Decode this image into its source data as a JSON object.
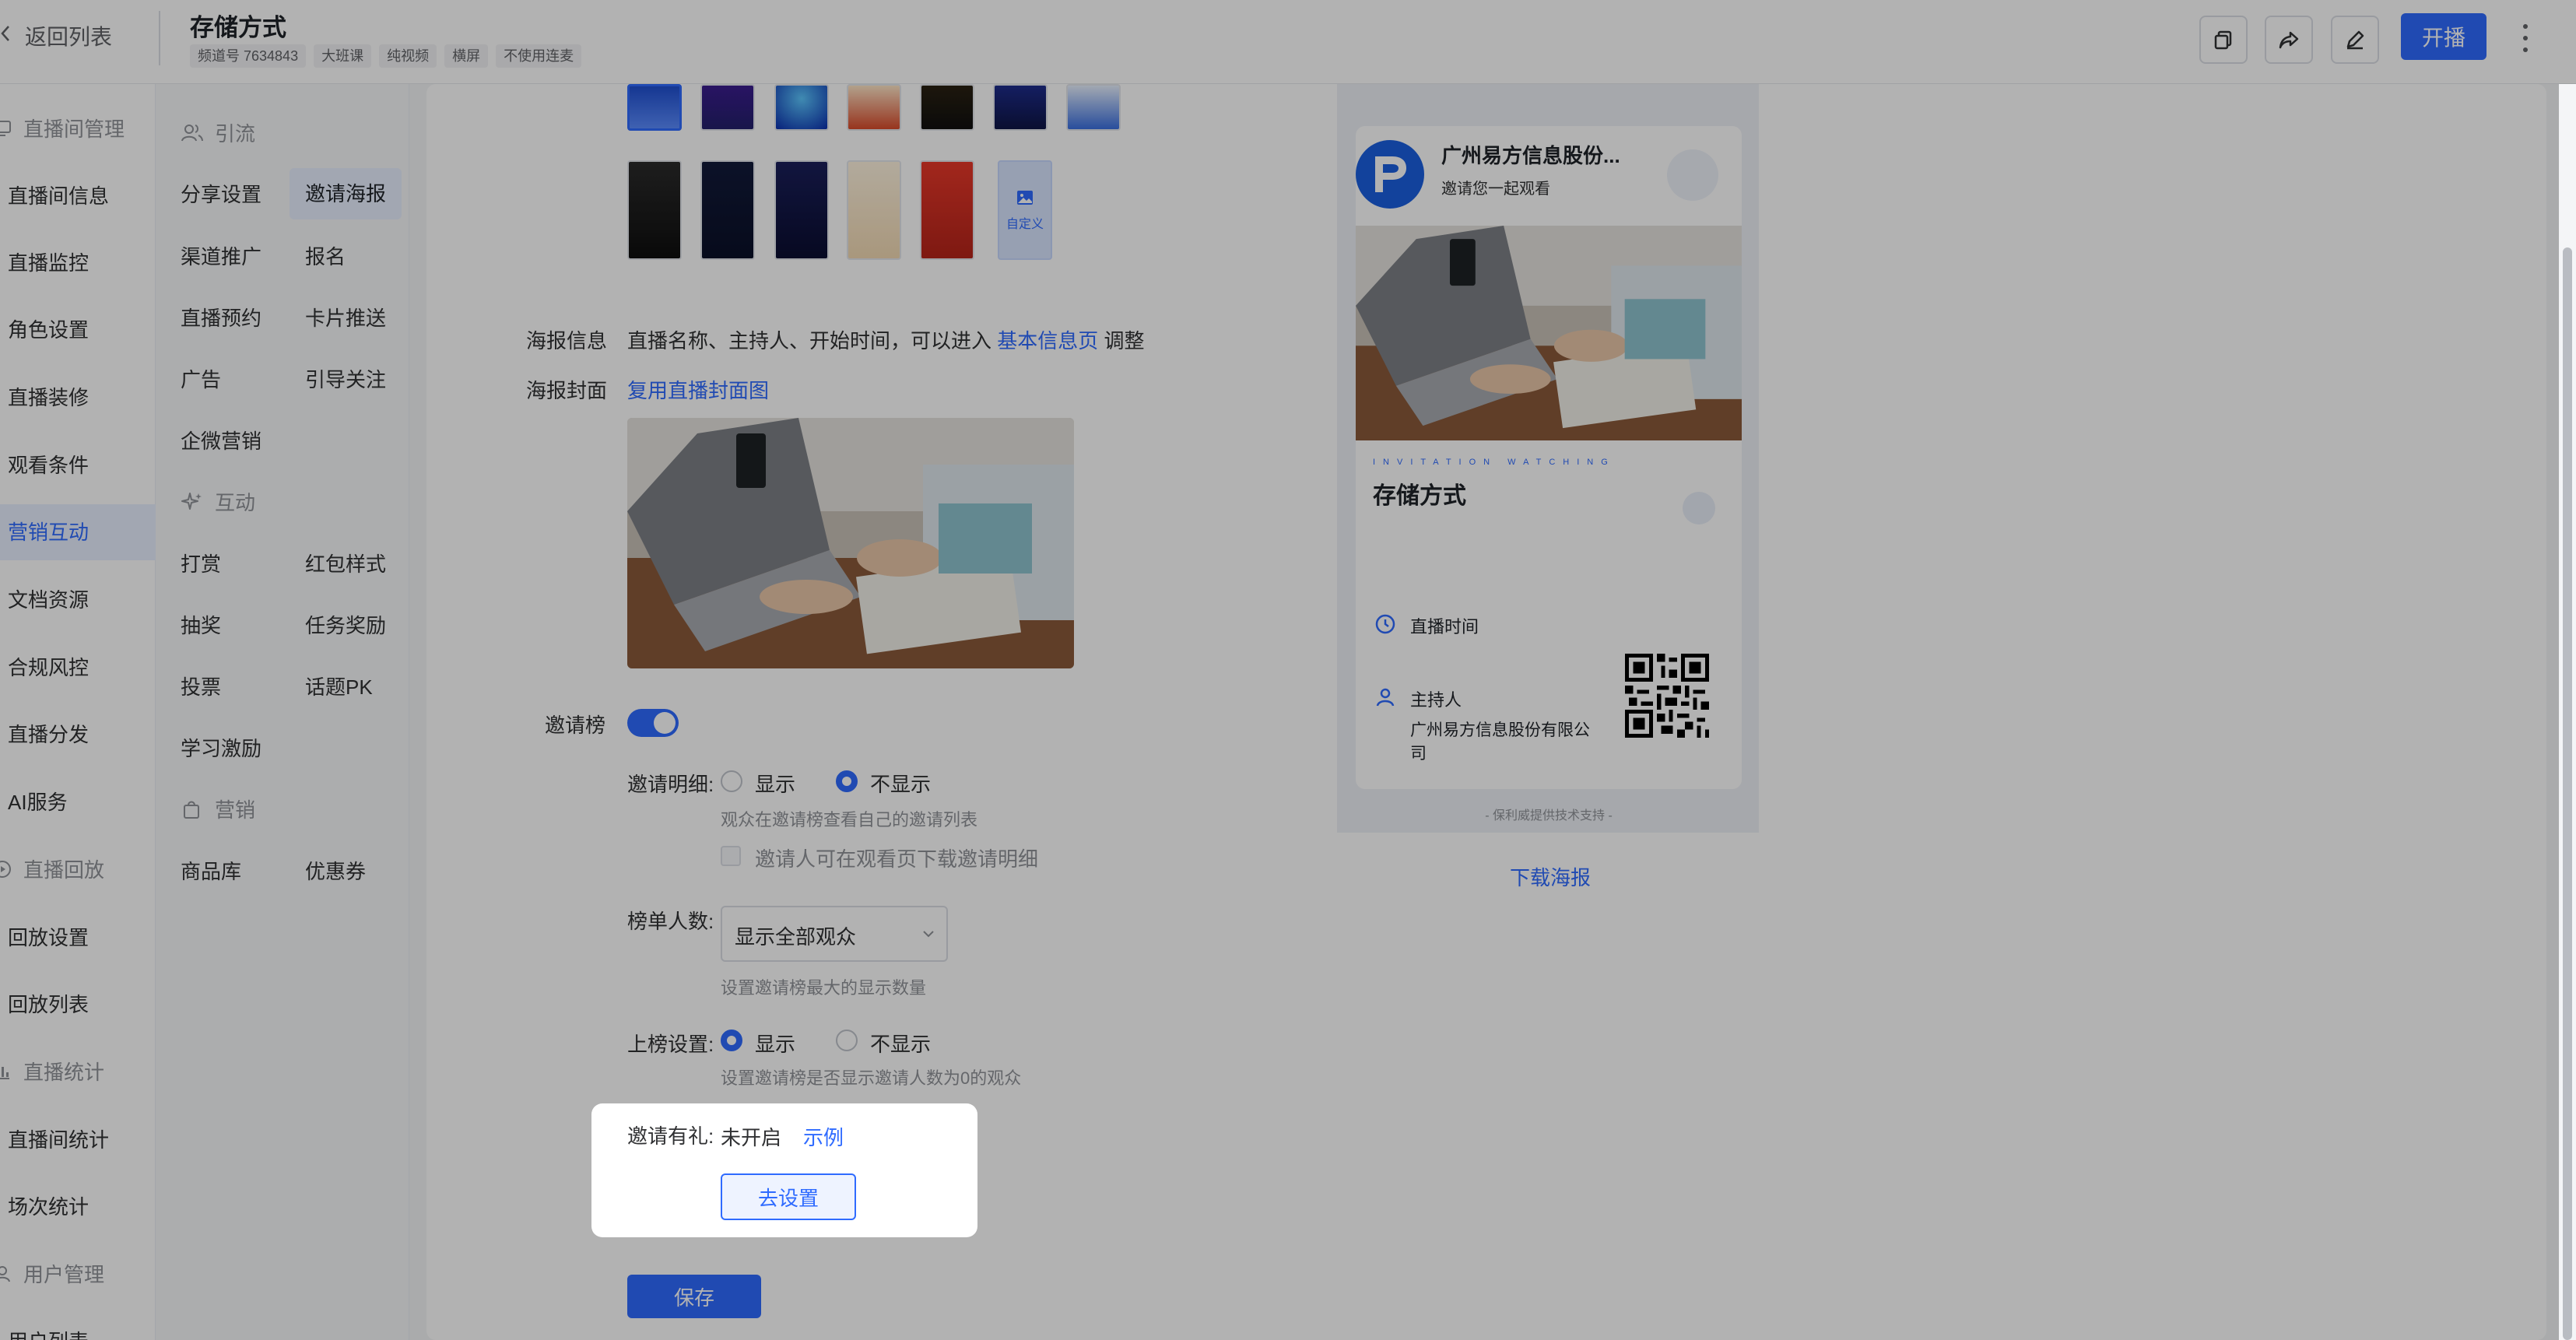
{
  "header": {
    "back_label": "返回列表",
    "title": "存储方式",
    "tags": [
      "频道号 7634843",
      "大班课",
      "纯视频",
      "横屏",
      "不使用连麦"
    ],
    "start_live_label": "开播"
  },
  "sidebar": {
    "items": [
      {
        "label": "直播间管理",
        "group": true
      },
      {
        "label": "直播间信息"
      },
      {
        "label": "直播监控"
      },
      {
        "label": "角色设置"
      },
      {
        "label": "直播装修"
      },
      {
        "label": "观看条件"
      },
      {
        "label": "营销互动",
        "active": true
      },
      {
        "label": "文档资源"
      },
      {
        "label": "合规风控"
      },
      {
        "label": "直播分发"
      },
      {
        "label": "AI服务"
      },
      {
        "label": "直播回放",
        "group": true
      },
      {
        "label": "回放设置"
      },
      {
        "label": "回放列表"
      },
      {
        "label": "直播统计",
        "group": true
      },
      {
        "label": "直播间统计"
      },
      {
        "label": "场次统计"
      },
      {
        "label": "用户管理",
        "group": true
      },
      {
        "label": "用户列表"
      }
    ]
  },
  "subnav": {
    "groups": [
      {
        "title": "引流",
        "items": [
          "分享设置",
          "邀请海报",
          "渠道推广",
          "报名",
          "直播预约",
          "卡片推送",
          "广告",
          "引导关注",
          "企微营销"
        ]
      },
      {
        "title": "互动",
        "items": [
          "打赏",
          "红包样式",
          "抽奖",
          "任务奖励",
          "投票",
          "话题PK",
          "学习激励"
        ]
      },
      {
        "title": "营销",
        "items": [
          "商品库",
          "优惠券"
        ]
      }
    ],
    "active": "邀请海报"
  },
  "poster": {
    "custom_label": "自定义",
    "info_label": "海报信息",
    "info_text": "直播名称、主持人、开始时间，可以进入",
    "info_link": "基本信息页",
    "info_suffix": "调整",
    "cover_label": "海报封面",
    "cover_link": "复用直播封面图"
  },
  "ranking": {
    "label": "邀请榜",
    "enabled": true,
    "detail_label": "邀请明细:",
    "show": "显示",
    "hide": "不显示",
    "detail_hint": "观众在邀请榜查看自己的邀请列表",
    "download_label": "邀请人可在观看页下载邀请明细",
    "count_label": "榜单人数:",
    "count_value": "显示全部观众",
    "count_hint": "设置邀请榜最大的显示数量",
    "onlist_label": "上榜设置:",
    "onlist_hint": "设置邀请榜是否显示邀请人数为0的观众"
  },
  "gift": {
    "label": "邀请有礼:",
    "status": "未开启",
    "example_link": "示例",
    "setup_button": "去设置"
  },
  "save_button": "保存",
  "preview": {
    "company": "广州易方信息股份...",
    "invite_text": "邀请您一起观看",
    "tagline": "INVITATION WATCHING",
    "live_title": "存储方式",
    "time_label": "直播时间",
    "host_label": "主持人",
    "host_name": "广州易方信息股份有限公司",
    "support": "- 保利威提供技术支持 -",
    "download": "下载海报"
  },
  "colors": {
    "accent": "#2f6bff"
  }
}
